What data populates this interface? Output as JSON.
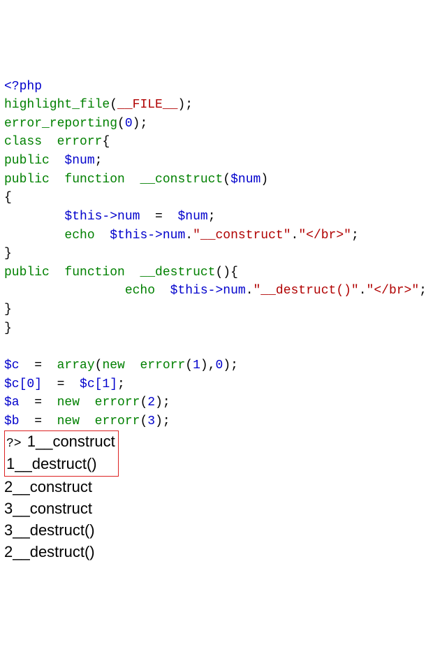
{
  "code": {
    "php_open": "<?php",
    "hl_func": "highlight_file",
    "file_const": "__FILE__",
    "err_func": "error_reporting",
    "zero": "0",
    "kw_class": "class",
    "cls_name": "errorr",
    "kw_public": "public",
    "var_num": "$num",
    "kw_function": "function",
    "m_construct": "__construct",
    "param_num": "$num",
    "thisnum": "$this->num",
    "kw_echo": "echo",
    "str_construct": "\"__construct\"",
    "str_br": "\"</br>\"",
    "m_destruct": "__destruct",
    "str_destruct": "\"__destruct()\"",
    "var_c": "$c",
    "arr": "array",
    "kw_new": "new",
    "one": "1",
    "comma0": "0",
    "c0": "$c[0]",
    "c1": "$c[1]",
    "var_a": "$a",
    "two": "2",
    "var_b": "$b",
    "three": "3",
    "php_close": "?>"
  },
  "output": {
    "l1": "1__construct",
    "l2": "1__destruct()",
    "l3": "2__construct",
    "l4": "3__construct",
    "l5": "3__destruct()",
    "l6": "2__destruct()"
  }
}
